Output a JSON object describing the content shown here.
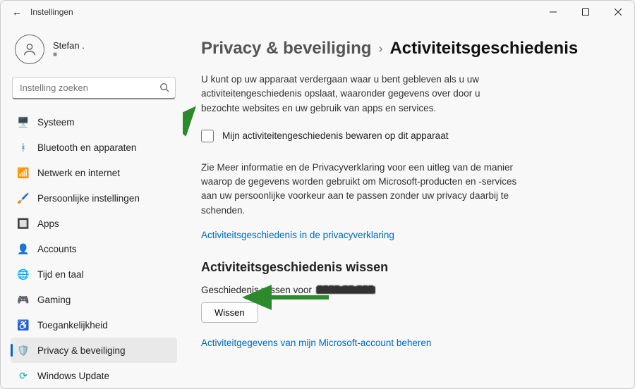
{
  "window": {
    "title": "Instellingen"
  },
  "user": {
    "name": "Stefan .",
    "sub": "■"
  },
  "search": {
    "placeholder": "Instelling zoeken"
  },
  "nav": [
    {
      "label": "Systeem"
    },
    {
      "label": "Bluetooth en apparaten"
    },
    {
      "label": "Netwerk en internet"
    },
    {
      "label": "Persoonlijke instellingen"
    },
    {
      "label": "Apps"
    },
    {
      "label": "Accounts"
    },
    {
      "label": "Tijd en taal"
    },
    {
      "label": "Gaming"
    },
    {
      "label": "Toegankelijkheid"
    },
    {
      "label": "Privacy & beveiliging"
    },
    {
      "label": "Windows Update"
    }
  ],
  "breadcrumb": {
    "parent": "Privacy & beveiliging",
    "current": "Activiteitsgeschiedenis"
  },
  "main": {
    "intro": "U kunt op uw apparaat verdergaan waar u bent gebleven als u uw activiteitengeschiedenis opslaat, waaronder gegevens over door u bezochte websites en uw gebruik van apps en services.",
    "checkbox_label": "Mijn activiteitengeschiedenis bewaren op dit apparaat",
    "privacy_paragraph": "Zie Meer informatie en de Privacyverklaring voor een uitleg van de manier waarop de gegevens worden gebruikt om Microsoft-producten en -services aan uw persoonlijke voorkeur aan te passen zonder uw privacy daarbij te schenden.",
    "privacy_link": "Activiteitsgeschiedenis in de privacyverklaring",
    "clear_heading": "Activiteitsgeschiedenis wissen",
    "clear_for_label": "Geschiedenis wissen voor",
    "clear_button": "Wissen",
    "manage_link": "Activiteitgegevens van mijn Microsoft-account beheren"
  }
}
